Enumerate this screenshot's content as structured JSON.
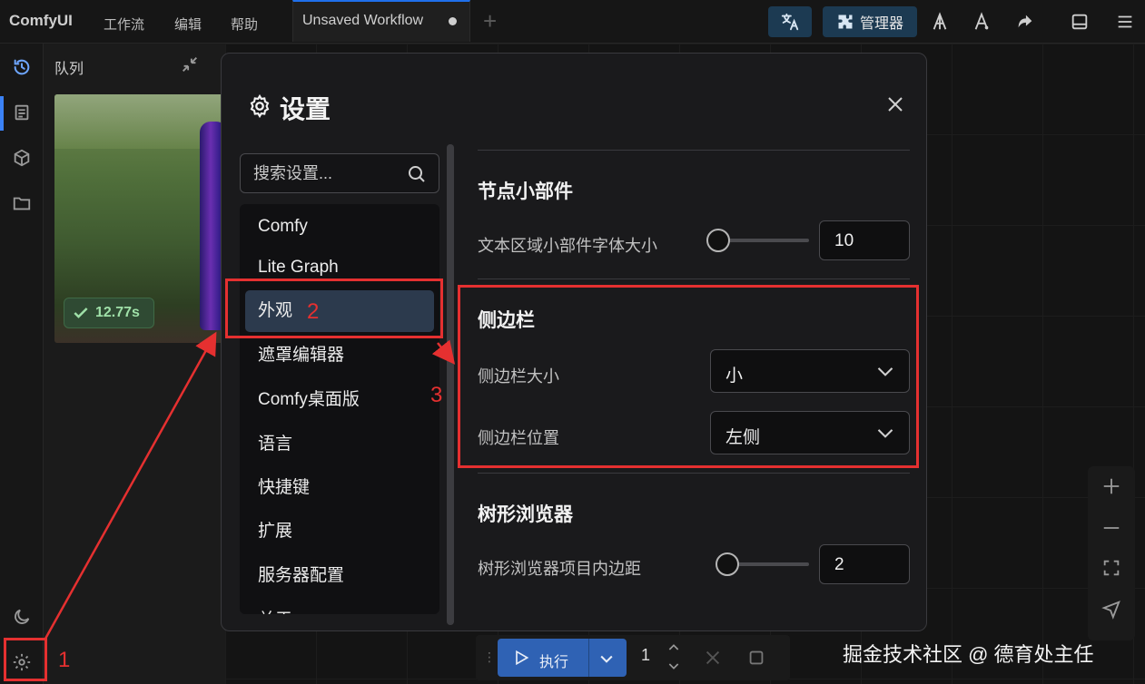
{
  "menubar": {
    "app_name": "ComfyUI",
    "menus": [
      "工作流",
      "编辑",
      "帮助"
    ],
    "tab_label": "Unsaved Workflow",
    "manager_label": "管理器"
  },
  "queue": {
    "title": "队列",
    "badge": "12.77s"
  },
  "dialog": {
    "title": "设置",
    "search_placeholder": "搜索设置...",
    "categories": [
      "Comfy",
      "Lite Graph",
      "外观",
      "遮罩编辑器",
      "Comfy桌面版",
      "语言",
      "快捷键",
      "扩展",
      "服务器配置",
      "关于"
    ],
    "active_category": "外观",
    "sections": {
      "node_widgets": {
        "title": "节点小部件",
        "row_label": "文本区域小部件字体大小",
        "value": "10",
        "slider_fraction": 0.0
      },
      "sidebar": {
        "title": "侧边栏",
        "size_label": "侧边栏大小",
        "size_value": "小",
        "position_label": "侧边栏位置",
        "position_value": "左侧"
      },
      "tree_browser": {
        "title": "树形浏览器",
        "row_label": "树形浏览器项目内边距",
        "value": "2",
        "slider_fraction": 0.1
      }
    }
  },
  "runbar": {
    "run_label": "执行",
    "count": "1"
  },
  "annotations": {
    "n1": "1",
    "n2": "2",
    "n3": "3",
    "color": "#e53030"
  },
  "watermark": "掘金技术社区 @ 德育处主任",
  "colors": {
    "accent": "#3b82f6",
    "run_button": "#2f62b4",
    "active_category_bg": "#2c3a4d"
  }
}
